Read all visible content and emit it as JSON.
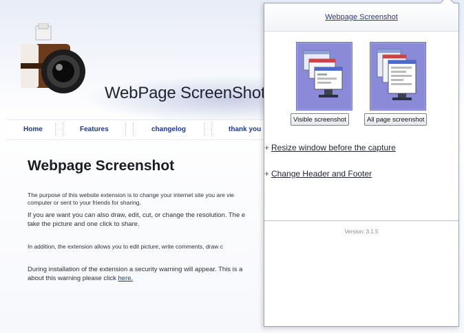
{
  "site": {
    "title": "WebPage ScreenShot",
    "nav": [
      "Home",
      "Features",
      "changelog",
      "thank you"
    ],
    "content_title": "Webpage Screenshot",
    "paragraphs": [
      "The purpose of this website extension is to change your internet site you are vie",
      "computer or sent to your friends for sharing.",
      "If you are want you can also draw, edit, cut, or change the resolution. The e",
      "take the picture and one click to share.",
      "In addition, the extension allows you to edit picture, write comments, draw c",
      "During installation of the extension a security warning will appear. This is a",
      "about this warning please click"
    ],
    "here_link": "here."
  },
  "popup": {
    "title": "Webpage Screenshot",
    "buttons": {
      "visible": "Visible screenshot",
      "all_page": "All page screenshot"
    },
    "links": {
      "resize": "Resize window before the capture",
      "header_footer": "Change Header and Footer"
    },
    "bullet": "+",
    "version": "Version: 3.1.5"
  },
  "icons": {
    "camera": "camera-logo-icon",
    "visible_capture": "visible-screenshot-icon",
    "all_page_capture": "all-page-screenshot-icon"
  },
  "colors": {
    "accent": "#8a8ad8",
    "link": "#1d3a8a"
  }
}
